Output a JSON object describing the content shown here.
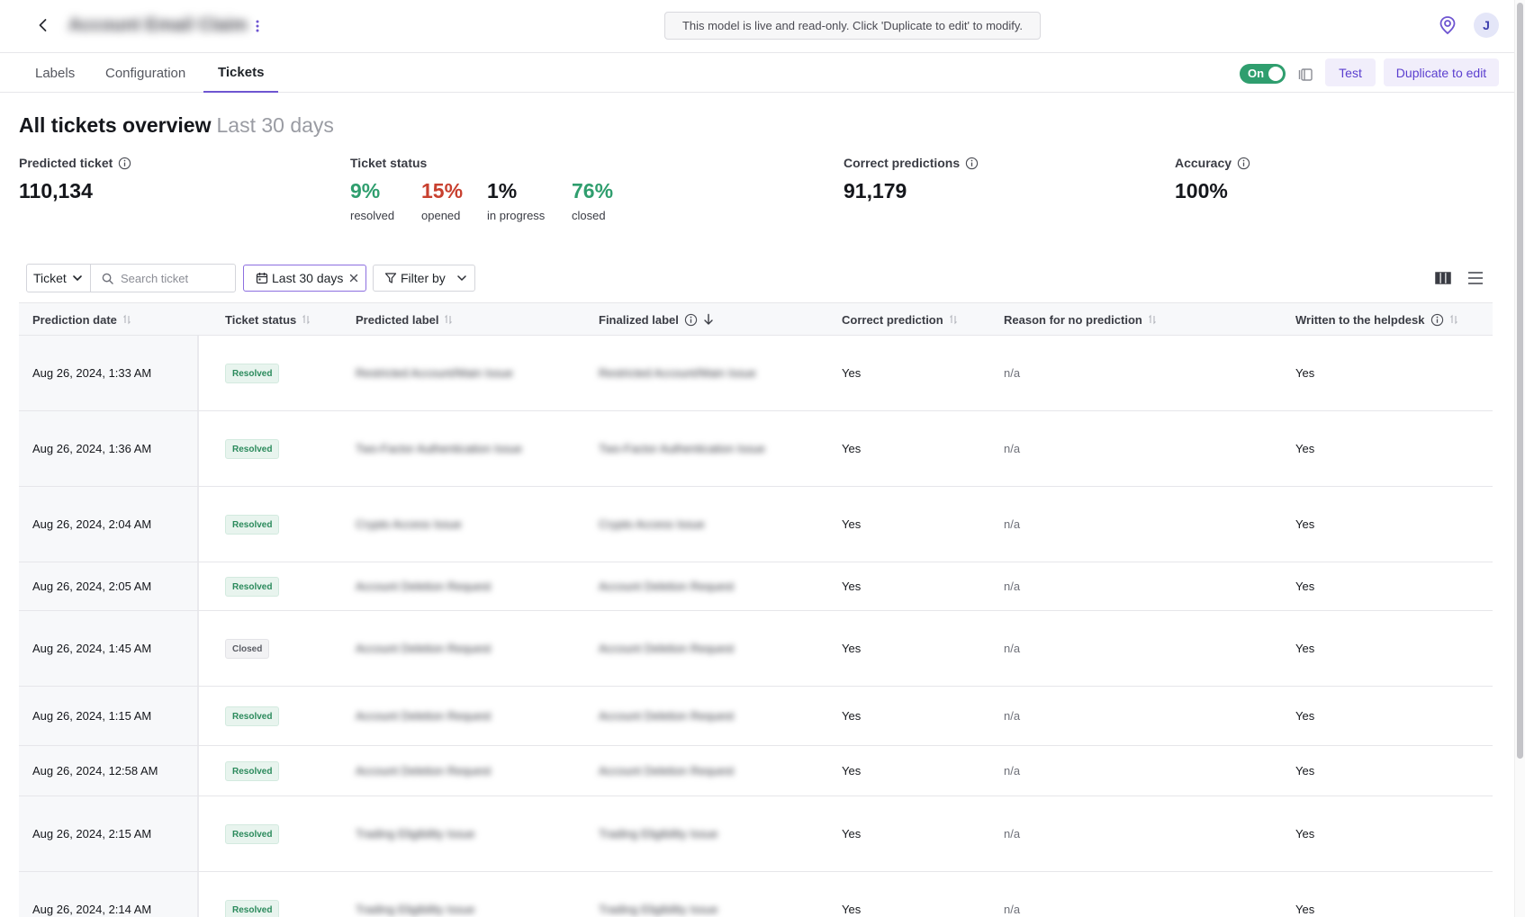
{
  "header": {
    "model_name": "Account Email Claim",
    "readonly_notice": "This model is live and read-only. Click 'Duplicate to edit' to modify.",
    "avatar_initial": "J"
  },
  "tabs": [
    {
      "label": "Labels",
      "active": false
    },
    {
      "label": "Configuration",
      "active": false
    },
    {
      "label": "Tickets",
      "active": true
    }
  ],
  "actions": {
    "toggle_label": "On",
    "toggle_state": true,
    "test_label": "Test",
    "duplicate_label": "Duplicate to edit"
  },
  "overview": {
    "title": "All tickets overview",
    "range": "Last 30 days",
    "predicted_ticket": {
      "label": "Predicted ticket",
      "value": "110,134"
    },
    "ticket_status": {
      "label": "Ticket status",
      "items": [
        {
          "pct": "9%",
          "name": "resolved",
          "color": "#2f9e6e"
        },
        {
          "pct": "15%",
          "name": "opened",
          "color": "#c8402f"
        },
        {
          "pct": "1%",
          "name": "in progress",
          "color": "#15171c"
        },
        {
          "pct": "76%",
          "name": "closed",
          "color": "#2f9e6e"
        }
      ]
    },
    "correct_predictions": {
      "label": "Correct predictions",
      "value": "91,179"
    },
    "accuracy": {
      "label": "Accuracy",
      "value": "100%"
    }
  },
  "toolbar": {
    "search_scope": "Ticket",
    "search_placeholder": "Search ticket",
    "date_chip": "Last 30 days",
    "filter_label": "Filter by"
  },
  "table": {
    "columns": [
      "Prediction date",
      "Ticket status",
      "Predicted label",
      "Finalized label",
      "Correct prediction",
      "Reason for no prediction",
      "Written to the helpdesk"
    ],
    "rows": [
      {
        "date": "Aug 26, 2024, 1:33 AM",
        "status": "Resolved",
        "predicted": "Restricted Account/Main Issue",
        "finalized": "Restricted Account/Main Issue",
        "correct": "Yes",
        "reason": "n/a",
        "written": "Yes"
      },
      {
        "date": "Aug 26, 2024, 1:36 AM",
        "status": "Resolved",
        "predicted": "Two-Factor Authentication Issue",
        "finalized": "Two-Factor Authentication Issue",
        "correct": "Yes",
        "reason": "n/a",
        "written": "Yes"
      },
      {
        "date": "Aug 26, 2024, 2:04 AM",
        "status": "Resolved",
        "predicted": "Crypto Access Issue",
        "finalized": "Crypto Access Issue",
        "correct": "Yes",
        "reason": "n/a",
        "written": "Yes"
      },
      {
        "date": "Aug 26, 2024, 2:05 AM",
        "status": "Resolved",
        "predicted": "Account Deletion Request",
        "finalized": "Account Deletion Request",
        "correct": "Yes",
        "reason": "n/a",
        "written": "Yes"
      },
      {
        "date": "Aug 26, 2024, 1:45 AM",
        "status": "Closed",
        "predicted": "Account Deletion Request",
        "finalized": "Account Deletion Request",
        "correct": "Yes",
        "reason": "n/a",
        "written": "Yes"
      },
      {
        "date": "Aug 26, 2024, 1:15 AM",
        "status": "Resolved",
        "predicted": "Account Deletion Request",
        "finalized": "Account Deletion Request",
        "correct": "Yes",
        "reason": "n/a",
        "written": "Yes"
      },
      {
        "date": "Aug 26, 2024, 12:58 AM",
        "status": "Resolved",
        "predicted": "Account Deletion Request",
        "finalized": "Account Deletion Request",
        "correct": "Yes",
        "reason": "n/a",
        "written": "Yes"
      },
      {
        "date": "Aug 26, 2024, 2:15 AM",
        "status": "Resolved",
        "predicted": "Trading Eligibility Issue",
        "finalized": "Trading Eligibility Issue",
        "correct": "Yes",
        "reason": "n/a",
        "written": "Yes"
      },
      {
        "date": "Aug 26, 2024, 2:14 AM",
        "status": "Resolved",
        "predicted": "Trading Eligibility Issue",
        "finalized": "Trading Eligibility Issue",
        "correct": "Yes",
        "reason": "n/a",
        "written": "Yes"
      }
    ]
  },
  "icons": [
    "back-arrow-icon",
    "kebab-menu-icon",
    "help-pin-icon",
    "info-icon",
    "panel-toggle-icon",
    "chevron-down-icon",
    "search-icon",
    "calendar-icon",
    "close-icon",
    "filter-icon",
    "sort-icon",
    "sort-desc-icon",
    "columns-icon",
    "list-density-icon"
  ],
  "colors": {
    "accent": "#6e55d1",
    "success": "#2f9e6e",
    "danger": "#c8402f"
  }
}
